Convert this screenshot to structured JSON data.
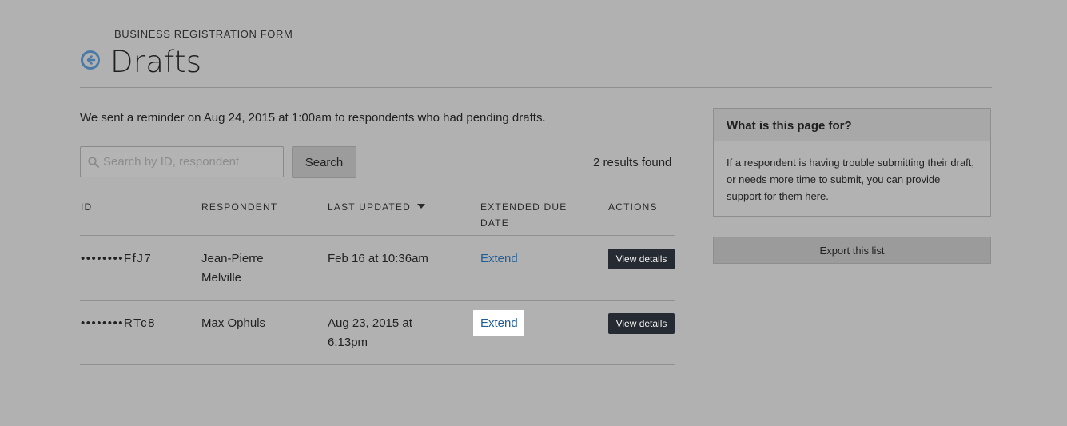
{
  "header": {
    "eyebrow": "BUSINESS REGISTRATION FORM",
    "title": "Drafts"
  },
  "reminder": "We sent a reminder on Aug 24, 2015 at 1:00am to respondents who had pending drafts.",
  "search": {
    "placeholder": "Search by ID, respondent",
    "value": "",
    "button_label": "Search"
  },
  "results_count": "2 results found",
  "table": {
    "columns": {
      "id": "ID",
      "respondent": "RESPONDENT",
      "last_updated": "LAST UPDATED",
      "extended_due_line1": "EXTENDED DUE",
      "extended_due_line2": "DATE",
      "actions": "ACTIONS"
    },
    "rows": [
      {
        "id": "••••••••FfJ7",
        "respondent_line1": "Jean-Pierre",
        "respondent_line2": "Melville",
        "last_updated_line1": "Feb 16 at 10:36am",
        "last_updated_line2": "",
        "extend": "Extend",
        "view": "View details"
      },
      {
        "id": "••••••••RTc8",
        "respondent_line1": "Max Ophuls",
        "respondent_line2": "",
        "last_updated_line1": "Aug 23, 2015 at",
        "last_updated_line2": "6:13pm",
        "extend": "Extend",
        "view": "View details"
      }
    ]
  },
  "help": {
    "title": "What is this page for?",
    "body": "If a respondent is having trouble submitting their draft, or needs more time to submit, you can provide support for them here."
  },
  "export_label": "Export this list",
  "colors": {
    "overlay_bg": "#b1b1b1",
    "link": "#1f5e99",
    "dark_button": "#262b33",
    "back_icon": "#4a7aa8"
  },
  "icons": {
    "back": "circle-arrow-left-icon",
    "search": "magnifier-icon",
    "sort": "caret-down-icon"
  }
}
